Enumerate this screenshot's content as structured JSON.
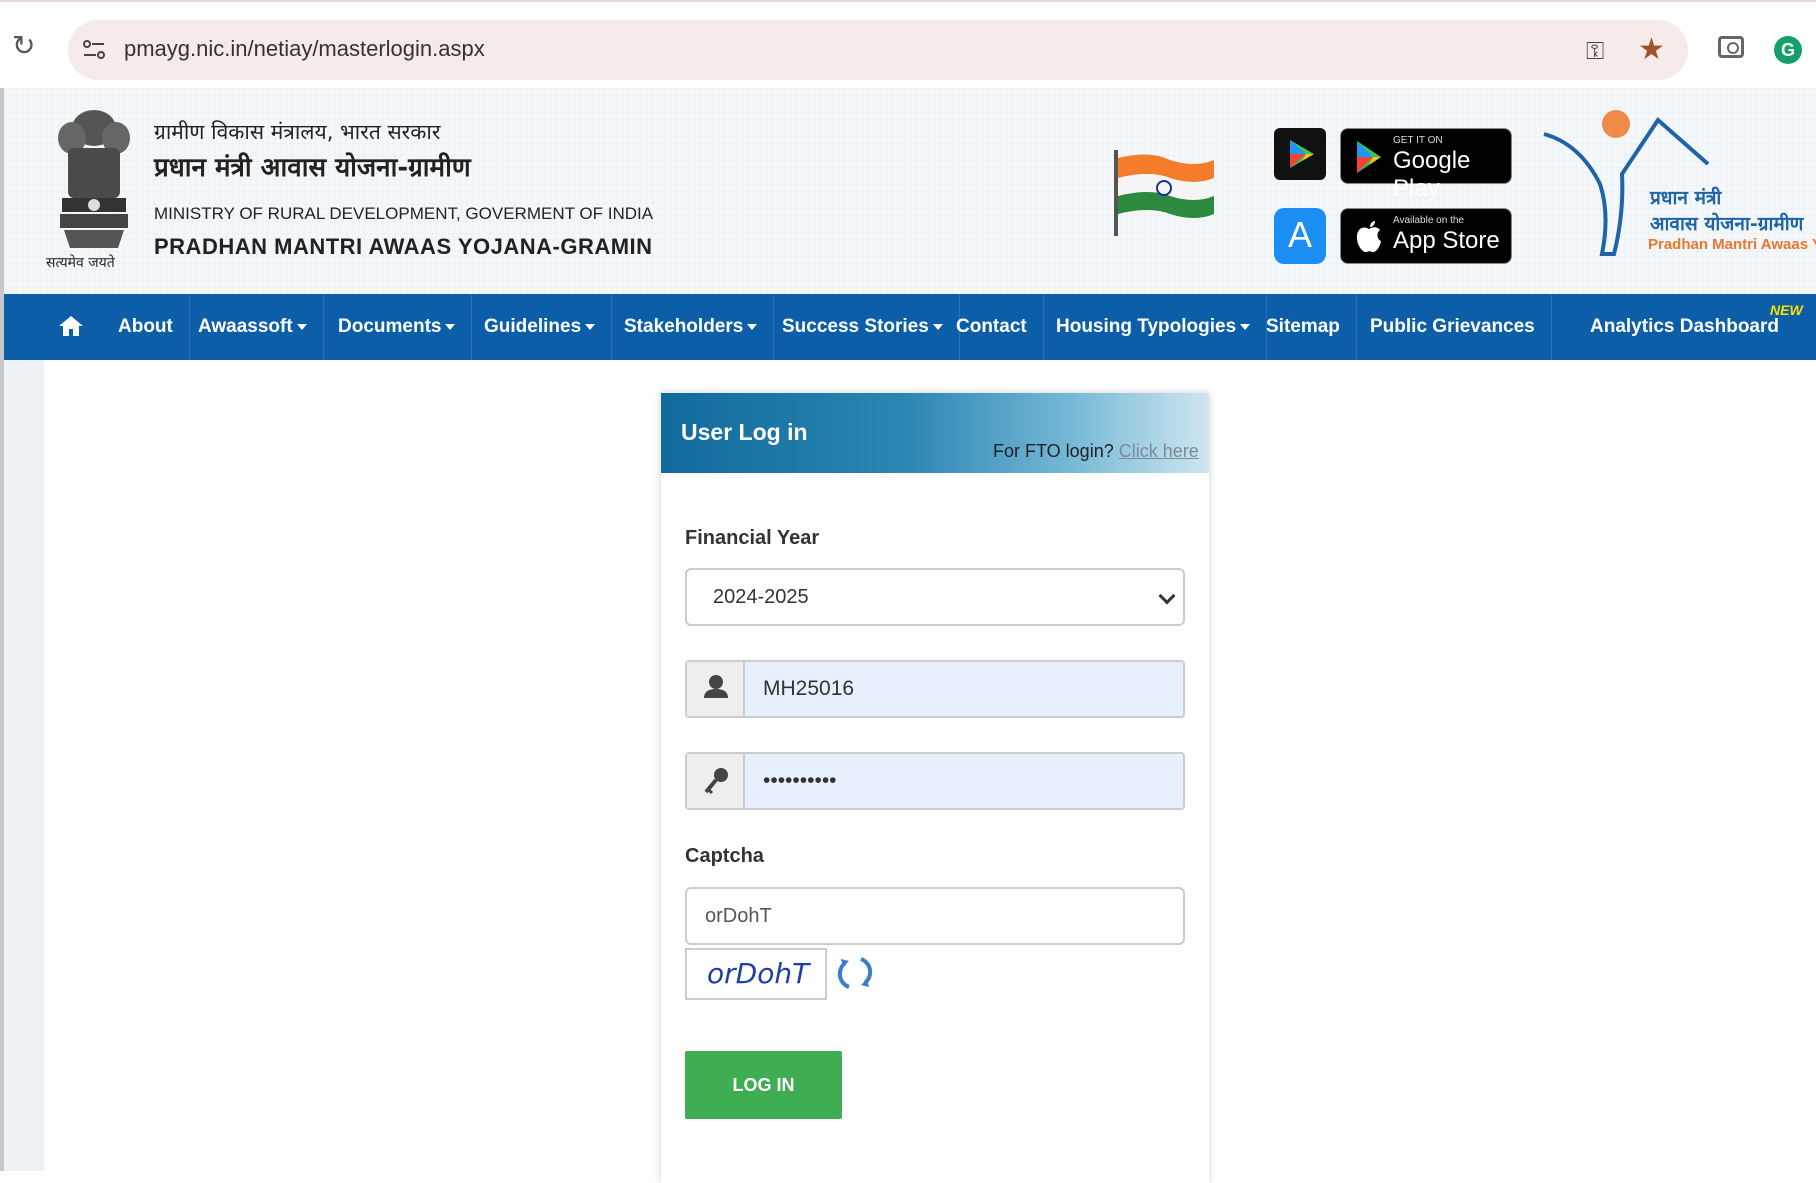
{
  "browser": {
    "url": "pmayg.nic.in/netiay/masterlogin.aspx"
  },
  "header": {
    "satyamev": "सत्यमेव जयते",
    "hindi_ministry": "ग्रामीण विकास मंत्रालय, भारत सरकार",
    "hindi_title": "प्रधान मंत्री आवास योजना-ग्रामीण",
    "eng_ministry": "MINISTRY OF RURAL DEVELOPMENT, GOVERMENT OF INDIA",
    "eng_title": "PRADHAN MANTRI AWAAS YOJANA-GRAMIN",
    "google_play_small": "GET IT ON",
    "google_play_big": "Google Play",
    "app_store_small": "Available on the",
    "app_store_big": "App Store",
    "logo_line1": "प्रधान मंत्री",
    "logo_line2": "आवास योजना-ग्रामीण",
    "logo_line3": "Pradhan Mantri Awaas Yojana-Gramin"
  },
  "nav": {
    "items": [
      {
        "label": "About"
      },
      {
        "label": "Awaassoft"
      },
      {
        "label": "Documents"
      },
      {
        "label": "Guidelines"
      },
      {
        "label": "Stakeholders"
      },
      {
        "label": "Success Stories"
      },
      {
        "label": "Contact"
      },
      {
        "label": "Housing Typologies"
      },
      {
        "label": "Sitemap"
      },
      {
        "label": "Public Grievances"
      },
      {
        "label": "Analytics Dashboard"
      }
    ],
    "new_badge": "NEW"
  },
  "login": {
    "title": "User Log in",
    "fto_prefix": "For FTO login? ",
    "fto_link": "Click here",
    "financial_year_label": "Financial Year",
    "financial_year_value": "2024-2025",
    "username_value": "MH25016",
    "password_value": "••••••••••",
    "captcha_label": "Captcha",
    "captcha_input_value": "orDohT",
    "captcha_image_text": "orDohT",
    "login_button": "LOG IN"
  },
  "colors": {
    "nav_bg": "#0c5ea8",
    "login_button": "#3fad52",
    "input_autofill_bg": "#e8f0fd"
  }
}
